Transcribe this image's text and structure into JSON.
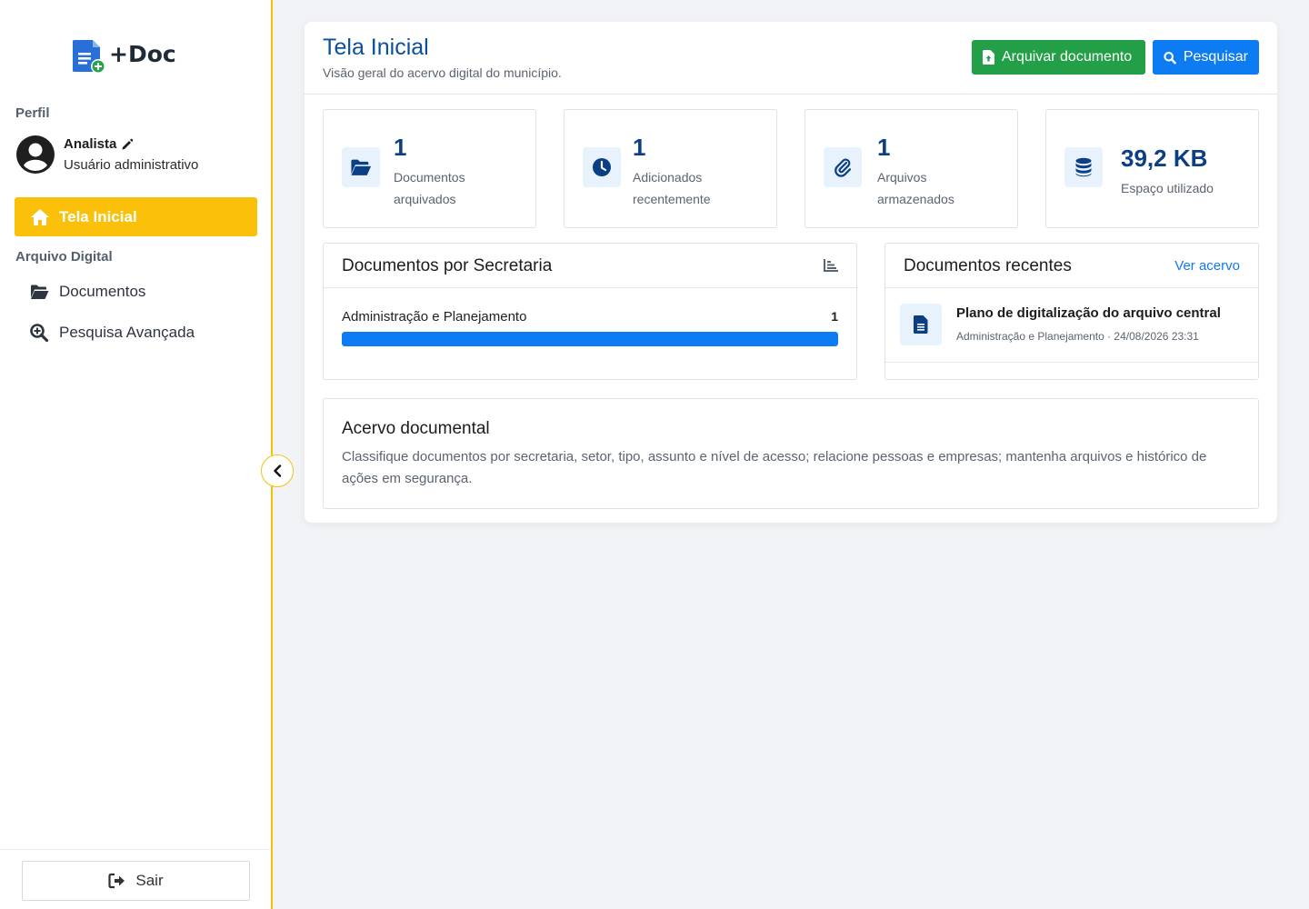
{
  "app": {
    "name": "+Doc"
  },
  "sidebar": {
    "profile_section": "Perfil",
    "user": {
      "name": "Analista",
      "role": "Usuário administrativo"
    },
    "home_label": "Tela Inicial",
    "archive_section": "Arquivo Digital",
    "items": [
      {
        "label": "Documentos",
        "icon": "folder-open-icon"
      },
      {
        "label": "Pesquisa Avançada",
        "icon": "search-plus-icon"
      }
    ],
    "logout_label": "Sair"
  },
  "header": {
    "title": "Tela Inicial",
    "subtitle": "Visão geral do acervo digital do município.",
    "archive_button": "Arquivar documento",
    "search_button": "Pesquisar"
  },
  "stats": [
    {
      "value": "1",
      "label_line1": "Documentos",
      "label_line2": "arquivados",
      "icon": "folder-open-icon"
    },
    {
      "value": "1",
      "label_line1": "Adicionados",
      "label_line2": "recentemente",
      "icon": "clock-icon"
    },
    {
      "value": "1",
      "label_line1": "Arquivos",
      "label_line2": "armazenados",
      "icon": "paperclip-icon"
    },
    {
      "value": "39,2 KB",
      "label_line1": "Espaço utilizado",
      "label_line2": "",
      "icon": "database-icon"
    }
  ],
  "by_secretaria": {
    "title": "Documentos por Secretaria",
    "rows": [
      {
        "label": "Administração e Planejamento",
        "count": "1",
        "fraction": 1.0
      }
    ]
  },
  "recent": {
    "title": "Documentos recentes",
    "link": "Ver acervo",
    "items": [
      {
        "title": "Plano de digitalização do arquivo central",
        "meta": "Administração e Planejamento · 24/08/2026 23:31"
      }
    ]
  },
  "acervo": {
    "title": "Acervo documental",
    "text": "Classifique documentos por secretaria, setor, tipo, assunto e nível de acesso; relacione pessoas e empresas; mantenha arquivos e histórico de ações em segurança."
  },
  "colors": {
    "accent_yellow": "#fbc10a",
    "primary_blue": "#0d7bf2",
    "success_green": "#23a047",
    "title_blue": "#0b4f9c"
  }
}
